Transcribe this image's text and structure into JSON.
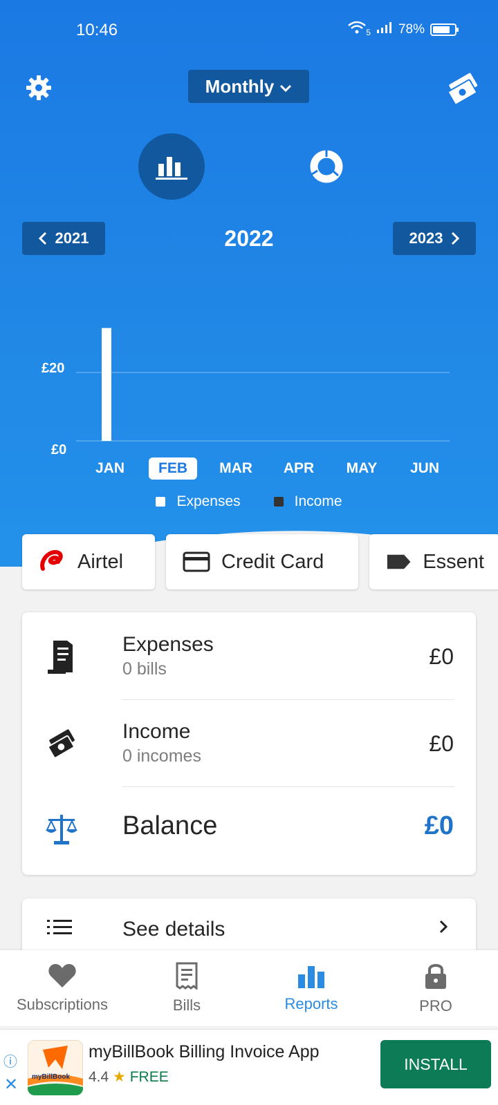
{
  "status_bar": {
    "time": "10:46",
    "network": "5",
    "battery": "78%"
  },
  "header": {
    "period_label": "Monthly"
  },
  "year_nav": {
    "prev": "2021",
    "current": "2022",
    "next": "2023"
  },
  "chart_data": {
    "type": "bar",
    "categories": [
      "JAN",
      "FEB",
      "MAR",
      "APR",
      "MAY",
      "JUN"
    ],
    "selected_category": "FEB",
    "series": [
      {
        "name": "Expenses",
        "values": [
          33,
          0,
          0,
          0,
          0,
          0
        ],
        "color": "#ffffff"
      },
      {
        "name": "Income",
        "values": [
          0,
          0,
          0,
          0,
          0,
          0
        ],
        "color": "#333333"
      }
    ],
    "y_ticks": [
      "£0",
      "£20"
    ],
    "ylim": [
      0,
      40
    ],
    "legend_placement": "bottom"
  },
  "chips": [
    {
      "label": "Airtel",
      "icon": "airtel-logo-icon"
    },
    {
      "label": "Credit Card",
      "icon": "credit-card-icon"
    },
    {
      "label": "Essent",
      "icon": "tag-icon"
    }
  ],
  "summary": {
    "expenses": {
      "title": "Expenses",
      "sub": "0 bills",
      "amount": "£0"
    },
    "income": {
      "title": "Income",
      "sub": "0 incomes",
      "amount": "£0"
    },
    "balance": {
      "title": "Balance",
      "amount": "£0",
      "accent": "#1f73c8"
    }
  },
  "details": {
    "label": "See details"
  },
  "nav": [
    {
      "label": "Subscriptions",
      "icon": "heart-icon"
    },
    {
      "label": "Bills",
      "icon": "bill-icon"
    },
    {
      "label": "Reports",
      "icon": "bar-chart-icon",
      "active": true
    },
    {
      "label": "PRO",
      "icon": "lock-icon"
    }
  ],
  "ad": {
    "title": "myBillBook Billing Invoice App",
    "rating": "4.4",
    "star": "★",
    "price": "FREE",
    "cta": "INSTALL",
    "logo_text": "myBillBook"
  }
}
